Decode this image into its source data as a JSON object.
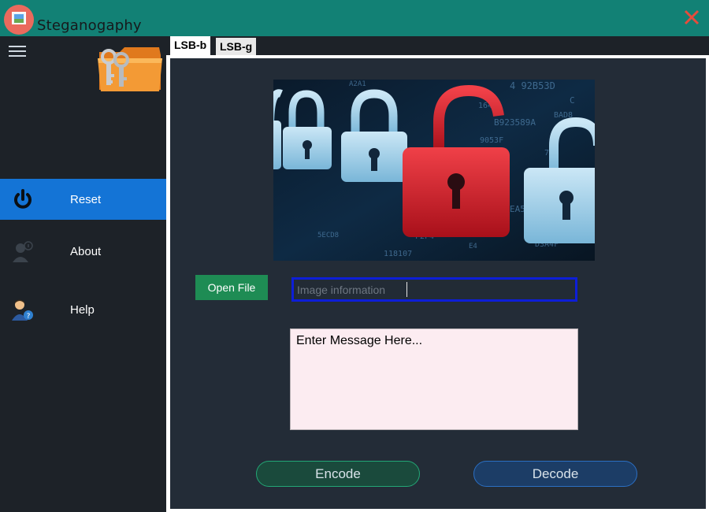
{
  "app": {
    "title": "Steganogaphy"
  },
  "icons": {
    "app": "image-icon",
    "close": "close-icon",
    "menu": "hamburger-menu-icon",
    "logo": "folder-keys-icon"
  },
  "sidebar": {
    "items": [
      {
        "label": "Reset",
        "icon": "power-icon",
        "active": true
      },
      {
        "label": "About",
        "icon": "user-info-icon",
        "active": false
      },
      {
        "label": "Help",
        "icon": "user-help-icon",
        "active": false
      }
    ]
  },
  "tabs": [
    {
      "label": "LSB-b",
      "active": true
    },
    {
      "label": "LSB-g",
      "active": false
    }
  ],
  "main": {
    "open_file_label": "Open File",
    "info_placeholder": "Image information",
    "message_placeholder": "Enter Message Here...",
    "encode_label": "Encode",
    "decode_label": "Decode"
  },
  "hero_glyphs": [
    "A2A1",
    "4 92B53D",
    "1647",
    "C",
    "BAD8",
    "B923589A",
    "9053F",
    "7D7",
    "EA525",
    "4",
    "D3A4F",
    "118107",
    "F2F4",
    "E4",
    "5ECD8"
  ],
  "colors": {
    "titlebar": "#128175",
    "sidebar": "#1d2228",
    "active_item": "#1474d6",
    "panel": "#232c37",
    "open_file": "#1e8c54",
    "input_border": "#0d1ed8",
    "message_bg": "#fcecf1",
    "close": "#e74c3c"
  }
}
